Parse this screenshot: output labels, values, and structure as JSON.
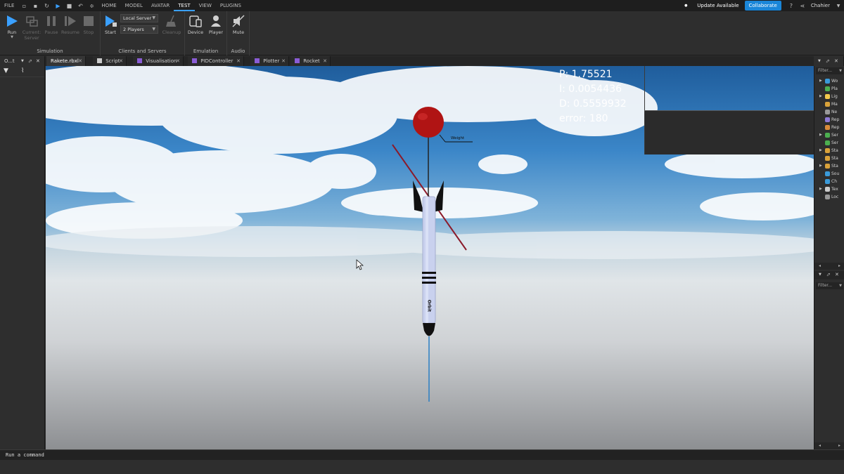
{
  "menubar": {
    "file": "FILE",
    "tabs": [
      "HOME",
      "MODEL",
      "AVATAR",
      "TEST",
      "VIEW",
      "PLUGINS"
    ],
    "active_tab": "TEST",
    "update": "Update Available",
    "collaborate": "Collaborate",
    "user": "Chahier"
  },
  "ribbon": {
    "simulation": {
      "label": "Simulation",
      "run": "Run",
      "current_server": "Current: Server",
      "pause": "Pause",
      "resume": "Resume",
      "stop": "Stop"
    },
    "clients": {
      "label": "Clients and Servers",
      "start": "Start",
      "server_select": "Local Server",
      "players_select": "2 Players",
      "cleanup": "Cleanup"
    },
    "emulation": {
      "label": "Emulation",
      "device": "Device",
      "player": "Player"
    },
    "audio": {
      "label": "Audio",
      "mute": "Mute"
    }
  },
  "left_panel": {
    "title": "O...t"
  },
  "tabs": [
    {
      "label": "Rakete.rbxl",
      "color": "#3a3a3a"
    },
    {
      "label": "Script",
      "color": "#cccccc"
    },
    {
      "label": "Visualisation",
      "color": "#8a5cd6"
    },
    {
      "label": "PIDController",
      "color": "#8a5cd6"
    },
    {
      "label": "Plotter",
      "color": "#8a5cd6"
    },
    {
      "label": "Rocket",
      "color": "#8a5cd6"
    }
  ],
  "viewport": {
    "hud": {
      "p": "P: 1.75521",
      "i": "I: 0.0054436",
      "d": "D: 0.5559932",
      "error": "error: 180"
    },
    "weight_label": "Weight",
    "rocket_text": "Orbit",
    "colors": {
      "balloon": "#b01414",
      "rocket_body": "#c9d1ee",
      "fin": "#111111",
      "red_line": "#8b1a2a",
      "blue_line": "#2a7fc4"
    }
  },
  "explorer": {
    "filter_placeholder": "Filter...",
    "items": [
      {
        "label": "Wo",
        "color": "#3a9ad9",
        "expand": true
      },
      {
        "label": "Pla",
        "color": "#4caf50",
        "expand": false
      },
      {
        "label": "Lig",
        "color": "#f2c94c",
        "expand": true
      },
      {
        "label": "Ma",
        "color": "#d9a23a",
        "expand": false
      },
      {
        "label": "Ne",
        "color": "#999999",
        "expand": false
      },
      {
        "label": "Rep",
        "color": "#8e7ad6",
        "expand": false
      },
      {
        "label": "Rep",
        "color": "#d98b3a",
        "expand": false
      },
      {
        "label": "Ser",
        "color": "#4caf50",
        "expand": true
      },
      {
        "label": "Ser",
        "color": "#4caf50",
        "expand": false
      },
      {
        "label": "Sta",
        "color": "#d9a23a",
        "expand": true
      },
      {
        "label": "Sta",
        "color": "#d9a23a",
        "expand": false
      },
      {
        "label": "Sta",
        "color": "#d9a23a",
        "expand": true
      },
      {
        "label": "Sou",
        "color": "#3a9ad9",
        "expand": false
      },
      {
        "label": "Ch",
        "color": "#3a9ad9",
        "expand": false
      },
      {
        "label": "Tex",
        "color": "#cccccc",
        "expand": true
      },
      {
        "label": "Loc",
        "color": "#999999",
        "expand": false
      }
    ],
    "properties_filter": "Filter..."
  },
  "command_bar": {
    "placeholder": "Run a command"
  }
}
